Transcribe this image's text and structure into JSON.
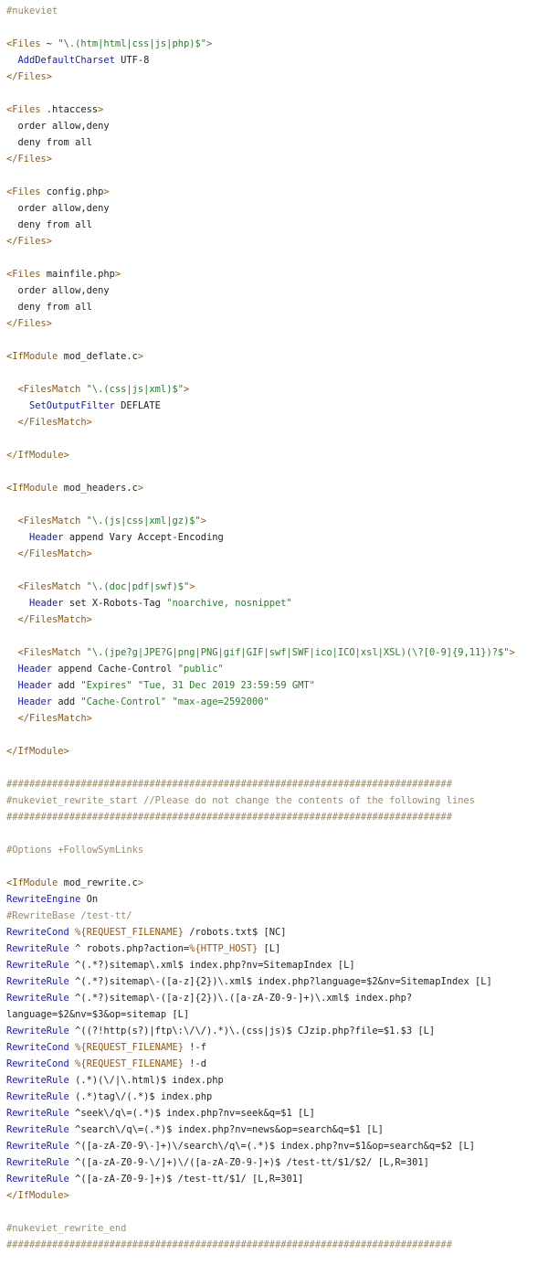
{
  "colors": {
    "comment": "#998a6a",
    "tag": "#8a5a1a",
    "directive": "#1a1aa6",
    "string": "#2a7a2a",
    "variable": "#8a5a1a",
    "plain": "#222222"
  },
  "lines": [
    [
      [
        "c",
        "#nukeviet"
      ]
    ],
    [],
    [
      [
        "t",
        "<Files"
      ],
      [
        "p",
        " ~ "
      ],
      [
        "s",
        "\"\\.(htm|html|css|js|php)$\""
      ],
      [
        "t",
        ">"
      ]
    ],
    [
      [
        "p",
        "  "
      ],
      [
        "d",
        "AddDefaultCharset"
      ],
      [
        "p",
        " UTF-8"
      ]
    ],
    [
      [
        "t",
        "</Files>"
      ]
    ],
    [],
    [
      [
        "t",
        "<Files"
      ],
      [
        "p",
        " .htaccess"
      ],
      [
        "t",
        ">"
      ]
    ],
    [
      [
        "p",
        "  order allow,deny"
      ]
    ],
    [
      [
        "p",
        "  deny from all"
      ]
    ],
    [
      [
        "t",
        "</Files>"
      ]
    ],
    [],
    [
      [
        "t",
        "<Files"
      ],
      [
        "p",
        " config.php"
      ],
      [
        "t",
        ">"
      ]
    ],
    [
      [
        "p",
        "  order allow,deny"
      ]
    ],
    [
      [
        "p",
        "  deny from all"
      ]
    ],
    [
      [
        "t",
        "</Files>"
      ]
    ],
    [],
    [
      [
        "t",
        "<Files"
      ],
      [
        "p",
        " mainfile.php"
      ],
      [
        "t",
        ">"
      ]
    ],
    [
      [
        "p",
        "  order allow,deny"
      ]
    ],
    [
      [
        "p",
        "  deny from all"
      ]
    ],
    [
      [
        "t",
        "</Files>"
      ]
    ],
    [],
    [
      [
        "t",
        "<IfModule"
      ],
      [
        "p",
        " mod_deflate.c"
      ],
      [
        "t",
        ">"
      ]
    ],
    [],
    [
      [
        "p",
        "  "
      ],
      [
        "t",
        "<FilesMatch"
      ],
      [
        "p",
        " "
      ],
      [
        "s",
        "\"\\.(css|js|xml)$\""
      ],
      [
        "t",
        ">"
      ]
    ],
    [
      [
        "p",
        "    "
      ],
      [
        "d",
        "SetOutputFilter"
      ],
      [
        "p",
        " DEFLATE"
      ]
    ],
    [
      [
        "p",
        "  "
      ],
      [
        "t",
        "</FilesMatch>"
      ]
    ],
    [],
    [
      [
        "t",
        "</IfModule>"
      ]
    ],
    [],
    [
      [
        "t",
        "<IfModule"
      ],
      [
        "p",
        " mod_headers.c"
      ],
      [
        "t",
        ">"
      ]
    ],
    [],
    [
      [
        "p",
        "  "
      ],
      [
        "t",
        "<FilesMatch"
      ],
      [
        "p",
        " "
      ],
      [
        "s",
        "\"\\.(js|css|xml|gz)$\""
      ],
      [
        "t",
        ">"
      ]
    ],
    [
      [
        "p",
        "    "
      ],
      [
        "d",
        "Header"
      ],
      [
        "p",
        " append Vary Accept-Encoding"
      ]
    ],
    [
      [
        "p",
        "  "
      ],
      [
        "t",
        "</FilesMatch>"
      ]
    ],
    [],
    [
      [
        "p",
        "  "
      ],
      [
        "t",
        "<FilesMatch"
      ],
      [
        "p",
        " "
      ],
      [
        "s",
        "\"\\.(doc|pdf|swf)$\""
      ],
      [
        "t",
        ">"
      ]
    ],
    [
      [
        "p",
        "    "
      ],
      [
        "d",
        "Header"
      ],
      [
        "p",
        " set X-Robots-Tag "
      ],
      [
        "s",
        "\"noarchive, nosnippet\""
      ]
    ],
    [
      [
        "p",
        "  "
      ],
      [
        "t",
        "</FilesMatch>"
      ]
    ],
    [],
    [
      [
        "p",
        "  "
      ],
      [
        "t",
        "<FilesMatch"
      ],
      [
        "p",
        " "
      ],
      [
        "s",
        "\"\\.(jpe?g|JPE?G|png|PNG|gif|GIF|swf|SWF|ico|ICO|xsl|XSL)(\\?[0-9]{9,11})?$\""
      ],
      [
        "t",
        ">"
      ]
    ],
    [
      [
        "p",
        "  "
      ],
      [
        "d",
        "Header"
      ],
      [
        "p",
        " append Cache-Control "
      ],
      [
        "s",
        "\"public\""
      ]
    ],
    [
      [
        "p",
        "  "
      ],
      [
        "d",
        "Header"
      ],
      [
        "p",
        " add "
      ],
      [
        "s",
        "\"Expires\""
      ],
      [
        "p",
        " "
      ],
      [
        "s",
        "\"Tue, 31 Dec 2019 23:59:59 GMT\""
      ]
    ],
    [
      [
        "p",
        "  "
      ],
      [
        "d",
        "Header"
      ],
      [
        "p",
        " add "
      ],
      [
        "s",
        "\"Cache-Control\""
      ],
      [
        "p",
        " "
      ],
      [
        "s",
        "\"max-age=2592000\""
      ]
    ],
    [
      [
        "p",
        "  "
      ],
      [
        "t",
        "</FilesMatch>"
      ]
    ],
    [],
    [
      [
        "t",
        "</IfModule>"
      ]
    ],
    [],
    [
      [
        "c",
        "##############################################################################"
      ]
    ],
    [
      [
        "c",
        "#nukeviet_rewrite_start //Please do not change the contents of the following lines"
      ]
    ],
    [
      [
        "c",
        "##############################################################################"
      ]
    ],
    [],
    [
      [
        "c",
        "#Options +FollowSymLinks"
      ]
    ],
    [],
    [
      [
        "t",
        "<IfModule"
      ],
      [
        "p",
        " mod_rewrite.c"
      ],
      [
        "t",
        ">"
      ]
    ],
    [
      [
        "d",
        "RewriteEngine"
      ],
      [
        "p",
        " On"
      ]
    ],
    [
      [
        "c",
        "#RewriteBase /test-tt/"
      ]
    ],
    [
      [
        "d",
        "RewriteCond"
      ],
      [
        "p",
        " "
      ],
      [
        "v",
        "%{REQUEST_FILENAME}"
      ],
      [
        "p",
        " /robots.txt$ [NC]"
      ]
    ],
    [
      [
        "d",
        "RewriteRule"
      ],
      [
        "p",
        " ^ robots.php?action="
      ],
      [
        "v",
        "%{HTTP_HOST}"
      ],
      [
        "p",
        " [L]"
      ]
    ],
    [
      [
        "d",
        "RewriteRule"
      ],
      [
        "p",
        " ^(.*?)sitemap\\.xml$ index.php?nv=SitemapIndex [L]"
      ]
    ],
    [
      [
        "d",
        "RewriteRule"
      ],
      [
        "p",
        " ^(.*?)sitemap\\-([a-z]{2})\\.xml$ index.php?language=$2&nv=SitemapIndex [L]"
      ]
    ],
    [
      [
        "d",
        "RewriteRule"
      ],
      [
        "p",
        " ^(.*?)sitemap\\-([a-z]{2})\\.([a-zA-Z0-9-]+)\\.xml$ index.php?"
      ]
    ],
    [
      [
        "p",
        "language=$2&nv=$3&op=sitemap [L]"
      ]
    ],
    [
      [
        "d",
        "RewriteRule"
      ],
      [
        "p",
        " ^((?!http(s?)|ftp\\:\\/\\/).*)\\.(css|js)$ CJzip.php?file=$1.$3 [L]"
      ]
    ],
    [
      [
        "d",
        "RewriteCond"
      ],
      [
        "p",
        " "
      ],
      [
        "v",
        "%{REQUEST_FILENAME}"
      ],
      [
        "p",
        " !-f"
      ]
    ],
    [
      [
        "d",
        "RewriteCond"
      ],
      [
        "p",
        " "
      ],
      [
        "v",
        "%{REQUEST_FILENAME}"
      ],
      [
        "p",
        " !-d"
      ]
    ],
    [
      [
        "d",
        "RewriteRule"
      ],
      [
        "p",
        " (.*)(\\/|\\.html)$ index.php"
      ]
    ],
    [
      [
        "d",
        "RewriteRule"
      ],
      [
        "p",
        " (.*)tag\\/(.*)$ index.php"
      ]
    ],
    [
      [
        "d",
        "RewriteRule"
      ],
      [
        "p",
        " ^seek\\/q\\=(.*)$ index.php?nv=seek&q=$1 [L]"
      ]
    ],
    [
      [
        "d",
        "RewriteRule"
      ],
      [
        "p",
        " ^search\\/q\\=(.*)$ index.php?nv=news&op=search&q=$1 [L]"
      ]
    ],
    [
      [
        "d",
        "RewriteRule"
      ],
      [
        "p",
        " ^([a-zA-Z0-9\\-]+)\\/search\\/q\\=(.*)$ index.php?nv=$1&op=search&q=$2 [L]"
      ]
    ],
    [
      [
        "d",
        "RewriteRule"
      ],
      [
        "p",
        " ^([a-zA-Z0-9-\\/]+)\\/([a-zA-Z0-9-]+)$ /test-tt/$1/$2/ [L,R=301]"
      ]
    ],
    [
      [
        "d",
        "RewriteRule"
      ],
      [
        "p",
        " ^([a-zA-Z0-9-]+)$ /test-tt/$1/ [L,R=301]"
      ]
    ],
    [
      [
        "t",
        "</IfModule>"
      ]
    ],
    [],
    [
      [
        "c",
        "#nukeviet_rewrite_end"
      ]
    ],
    [
      [
        "c",
        "##############################################################################"
      ]
    ]
  ]
}
